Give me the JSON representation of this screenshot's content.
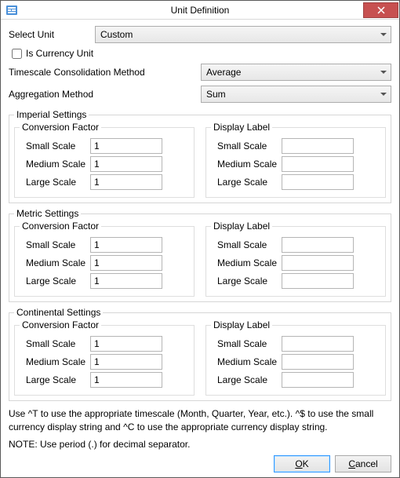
{
  "window": {
    "title": "Unit Definition"
  },
  "labels": {
    "select_unit": "Select Unit",
    "is_currency": "Is Currency Unit",
    "timescale_method": "Timescale Consolidation Method",
    "aggregation_method": "Aggregation Method",
    "conversion_factor": "Conversion Factor",
    "display_label": "Display Label",
    "small_scale": "Small Scale",
    "medium_scale": "Medium Scale",
    "large_scale": "Large Scale"
  },
  "selects": {
    "unit": "Custom",
    "timescale": "Average",
    "aggregation": "Sum"
  },
  "is_currency_checked": false,
  "groups": {
    "imperial": {
      "title": "Imperial Settings",
      "cf": {
        "small": "1",
        "medium": "1",
        "large": "1"
      },
      "dl": {
        "small": "",
        "medium": "",
        "large": ""
      }
    },
    "metric": {
      "title": "Metric Settings",
      "cf": {
        "small": "1",
        "medium": "1",
        "large": "1"
      },
      "dl": {
        "small": "",
        "medium": "",
        "large": ""
      }
    },
    "continental": {
      "title": "Continental Settings",
      "cf": {
        "small": "1",
        "medium": "1",
        "large": "1"
      },
      "dl": {
        "small": "",
        "medium": "",
        "large": ""
      }
    }
  },
  "footer": {
    "note1": "Use ^T to use the appropriate timescale (Month, Quarter, Year, etc.). ^$ to use the small currency display string and ^C to use the appropriate currency display string.",
    "note2": "NOTE: Use period (.) for decimal separator."
  },
  "buttons": {
    "ok_prefix": "O",
    "ok_rest": "K",
    "cancel_prefix": "C",
    "cancel_rest": "ancel"
  }
}
